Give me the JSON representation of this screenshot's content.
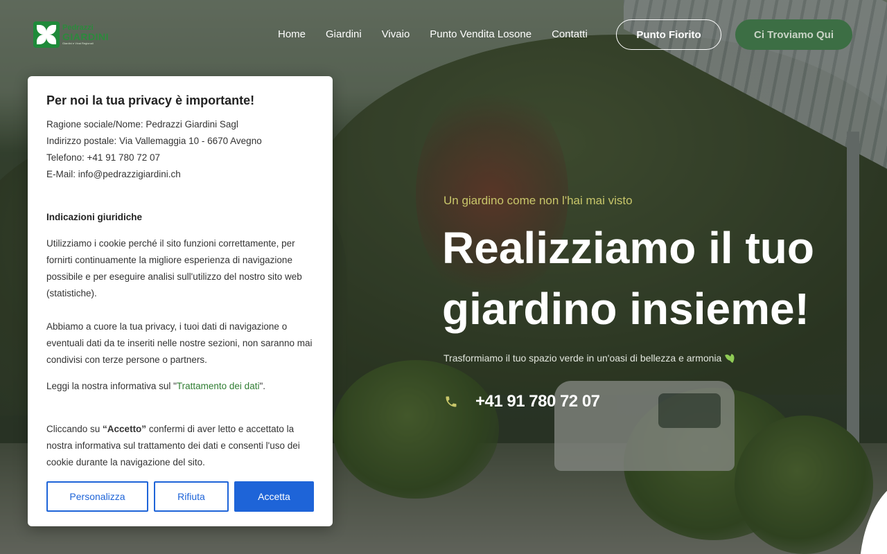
{
  "header": {
    "logo": {
      "line1": "Pedrazzi",
      "line2": "GIARDINI",
      "tagline": "Giardini e Vivai Regionali"
    },
    "nav": [
      {
        "label": "Home"
      },
      {
        "label": "Giardini"
      },
      {
        "label": "Vivaio"
      },
      {
        "label": "Punto Vendita Losone"
      },
      {
        "label": "Contatti"
      }
    ],
    "cta_outline": "Punto Fiorito",
    "cta_filled": "Ci Troviamo Qui"
  },
  "hero": {
    "kicker": "Un giardino come non l'hai mai visto",
    "title": "Realizziamo il tuo giardino insieme!",
    "subtitle": "Trasformiamo il tuo spazio verde in un'oasi di bellezza e armonia",
    "phone": "+41 91 780 72 07"
  },
  "privacy": {
    "title": "Per noi la tua privacy è importante!",
    "company": "Ragione sociale/Nome: Pedrazzi Giardini Sagl",
    "address": "Indirizzo postale: Via Vallemaggia 10 - 6670 Avegno",
    "phone": "Telefono: +41 91 780 72 07",
    "email_label": "E-Mail: ",
    "email": "info@pedrazzigiardini.ch",
    "legal_heading": "Indicazioni giuridiche",
    "para1": "Utilizziamo i cookie perché il sito funzioni correttamente, per fornirti continuamente la migliore esperienza di navigazione possibile e per eseguire analisi sull'utilizzo del nostro sito web (statistiche).",
    "para2": "Abbiamo a cuore la tua privacy, i tuoi dati di navigazione o eventuali dati da te inseriti nelle nostre sezioni, non saranno mai condivisi con terze persone o partners.",
    "para3_before": "Leggi la nostra informativa sul \"",
    "para3_link": "Trattamento dei dati",
    "para3_after": "\".",
    "para4_before": "Cliccando su ",
    "para4_strong": "“Accetto”",
    "para4_after": " confermi di aver letto e accettato la nostra informativa sul trattamento dei dati e consenti l'uso dei cookie durante la navigazione del sito.",
    "btn_customize": "Personalizza",
    "btn_reject": "Rifiuta",
    "btn_accept": "Accetta"
  },
  "colors": {
    "accent_blue": "#1e64d8",
    "brand_green": "#2c8a3c",
    "kicker_yellow": "#c8c66a"
  },
  "icons": {
    "phone": "phone-icon",
    "leaf": "leaf-icon"
  }
}
